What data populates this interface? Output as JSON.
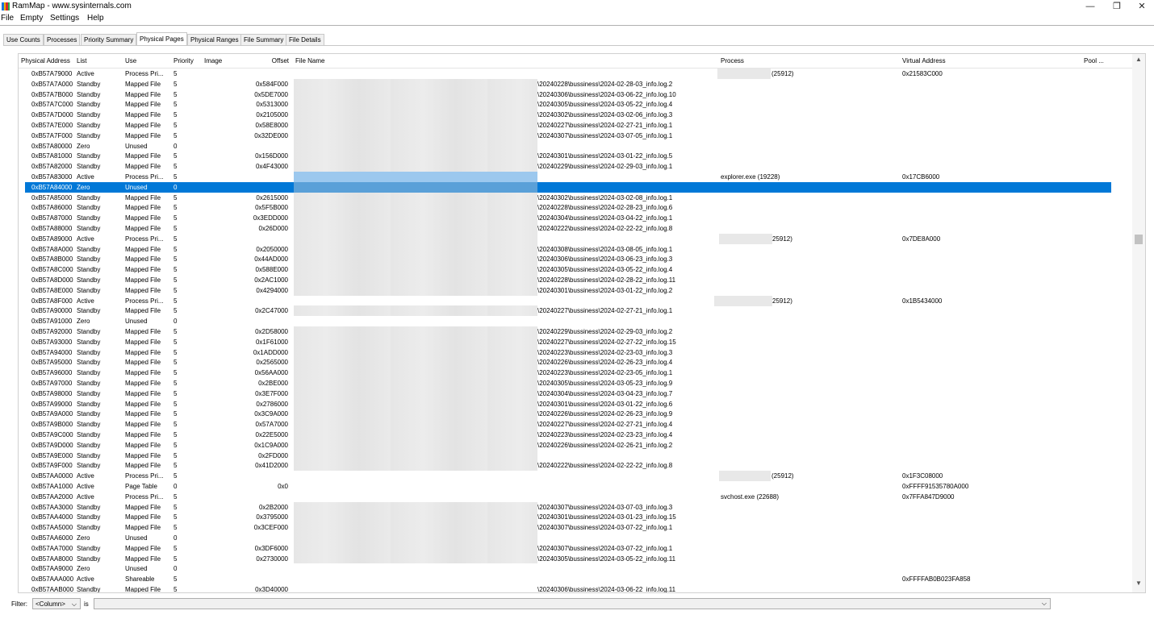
{
  "window": {
    "title": "RamMap - www.sysinternals.com",
    "icon_colors": [
      "#1a73d9",
      "#e8b100",
      "#d9232d",
      "#2aa845"
    ],
    "minimize_glyph": "—",
    "restore_glyph": "❐",
    "close_glyph": "✕"
  },
  "menu": [
    "File",
    "Empty",
    "Settings",
    "Help"
  ],
  "tabs": [
    "Use Counts",
    "Processes",
    "Priority Summary",
    "Physical Pages",
    "Physical Ranges",
    "File Summary",
    "File Details"
  ],
  "active_tab": "Physical Pages",
  "columns": [
    "Physical Address",
    "List",
    "Use",
    "Priority",
    "Image",
    "Offset",
    "File Name",
    "Process",
    "Virtual Address",
    "Pool ..."
  ],
  "rows": [
    {
      "addr": "0xB57A79000",
      "list": "Active",
      "use": "Process Pri...",
      "pri": "5",
      "offset": "",
      "file": "",
      "process": "(25912)",
      "va": "0x21583C000"
    },
    {
      "addr": "0xB57A7A000",
      "list": "Standby",
      "use": "Mapped File",
      "pri": "5",
      "offset": "0x584F000",
      "file": "\\20240228\\bussiness\\2024-02-28-03_info.log.2",
      "process": "",
      "va": ""
    },
    {
      "addr": "0xB57A7B000",
      "list": "Standby",
      "use": "Mapped File",
      "pri": "5",
      "offset": "0x5DE7000",
      "file": "\\20240306\\bussiness\\2024-03-06-22_info.log.10",
      "process": "",
      "va": ""
    },
    {
      "addr": "0xB57A7C000",
      "list": "Standby",
      "use": "Mapped File",
      "pri": "5",
      "offset": "0x5313000",
      "file": "\\20240305\\bussiness\\2024-03-05-22_info.log.4",
      "process": "",
      "va": ""
    },
    {
      "addr": "0xB57A7D000",
      "list": "Standby",
      "use": "Mapped File",
      "pri": "5",
      "offset": "0x2105000",
      "file": "\\20240302\\bussiness\\2024-03-02-06_info.log.3",
      "process": "",
      "va": ""
    },
    {
      "addr": "0xB57A7E000",
      "list": "Standby",
      "use": "Mapped File",
      "pri": "5",
      "offset": "0x58E8000",
      "file": "\\20240227\\bussiness\\2024-02-27-21_info.log.1",
      "process": "",
      "va": ""
    },
    {
      "addr": "0xB57A7F000",
      "list": "Standby",
      "use": "Mapped File",
      "pri": "5",
      "offset": "0x32DE000",
      "file": "\\20240307\\bussiness\\2024-03-07-05_info.log.1",
      "process": "",
      "va": ""
    },
    {
      "addr": "0xB57A80000",
      "list": "Zero",
      "use": "Unused",
      "pri": "0",
      "offset": "",
      "file": "",
      "process": "",
      "va": ""
    },
    {
      "addr": "0xB57A81000",
      "list": "Standby",
      "use": "Mapped File",
      "pri": "5",
      "offset": "0x156D000",
      "file": "\\20240301\\bussiness\\2024-03-01-22_info.log.5",
      "process": "",
      "va": ""
    },
    {
      "addr": "0xB57A82000",
      "list": "Standby",
      "use": "Mapped File",
      "pri": "5",
      "offset": "0x4F43000",
      "file": "\\20240229\\bussiness\\2024-02-29-03_info.log.1",
      "process": "",
      "va": ""
    },
    {
      "addr": "0xB57A83000",
      "list": "Active",
      "use": "Process Pri...",
      "pri": "5",
      "offset": "",
      "file": "",
      "process": "explorer.exe (19228)",
      "va": "0x17CB6000"
    },
    {
      "addr": "0xB57A84000",
      "list": "Zero",
      "use": "Unused",
      "pri": "0",
      "offset": "",
      "file": "",
      "process": "",
      "va": ""
    },
    {
      "addr": "0xB57A85000",
      "list": "Standby",
      "use": "Mapped File",
      "pri": "5",
      "offset": "0x2615000",
      "file": "\\20240302\\bussiness\\2024-03-02-08_info.log.1",
      "process": "",
      "va": ""
    },
    {
      "addr": "0xB57A86000",
      "list": "Standby",
      "use": "Mapped File",
      "pri": "5",
      "offset": "0x5F5B000",
      "file": "\\20240228\\bussiness\\2024-02-28-23_info.log.6",
      "process": "",
      "va": ""
    },
    {
      "addr": "0xB57A87000",
      "list": "Standby",
      "use": "Mapped File",
      "pri": "5",
      "offset": "0x3EDD000",
      "file": "\\20240304\\bussiness\\2024-03-04-22_info.log.1",
      "process": "",
      "va": ""
    },
    {
      "addr": "0xB57A88000",
      "list": "Standby",
      "use": "Mapped File",
      "pri": "5",
      "offset": "0x26D000",
      "file": "\\20240222\\bussiness\\2024-02-22-22_info.log.8",
      "process": "",
      "va": ""
    },
    {
      "addr": "0xB57A89000",
      "list": "Active",
      "use": "Process Pri...",
      "pri": "5",
      "offset": "",
      "file": "",
      "process": "25912)",
      "va": "0x7DE8A000"
    },
    {
      "addr": "0xB57A8A000",
      "list": "Standby",
      "use": "Mapped File",
      "pri": "5",
      "offset": "0x2050000",
      "file": "\\20240308\\bussiness\\2024-03-08-05_info.log.1",
      "process": "",
      "va": ""
    },
    {
      "addr": "0xB57A8B000",
      "list": "Standby",
      "use": "Mapped File",
      "pri": "5",
      "offset": "0x44AD000",
      "file": "\\20240306\\bussiness\\2024-03-06-23_info.log.3",
      "process": "",
      "va": ""
    },
    {
      "addr": "0xB57A8C000",
      "list": "Standby",
      "use": "Mapped File",
      "pri": "5",
      "offset": "0x588E000",
      "file": "\\20240305\\bussiness\\2024-03-05-22_info.log.4",
      "process": "",
      "va": ""
    },
    {
      "addr": "0xB57A8D000",
      "list": "Standby",
      "use": "Mapped File",
      "pri": "5",
      "offset": "0x2AC1000",
      "file": "\\20240228\\bussiness\\2024-02-28-22_info.log.11",
      "process": "",
      "va": ""
    },
    {
      "addr": "0xB57A8E000",
      "list": "Standby",
      "use": "Mapped File",
      "pri": "5",
      "offset": "0x4294000",
      "file": "\\20240301\\bussiness\\2024-03-01-22_info.log.2",
      "process": "",
      "va": ""
    },
    {
      "addr": "0xB57A8F000",
      "list": "Active",
      "use": "Process Pri...",
      "pri": "5",
      "offset": "",
      "file": "",
      "process": "25912)",
      "va": "0x1B5434000"
    },
    {
      "addr": "0xB57A90000",
      "list": "Standby",
      "use": "Mapped File",
      "pri": "5",
      "offset": "0x2C47000",
      "file": "\\20240227\\bussiness\\2024-02-27-21_info.log.1",
      "process": "",
      "va": ""
    },
    {
      "addr": "0xB57A91000",
      "list": "Zero",
      "use": "Unused",
      "pri": "0",
      "offset": "",
      "file": "",
      "process": "",
      "va": ""
    },
    {
      "addr": "0xB57A92000",
      "list": "Standby",
      "use": "Mapped File",
      "pri": "5",
      "offset": "0x2D58000",
      "file": "\\20240229\\bussiness\\2024-02-29-03_info.log.2",
      "process": "",
      "va": ""
    },
    {
      "addr": "0xB57A93000",
      "list": "Standby",
      "use": "Mapped File",
      "pri": "5",
      "offset": "0x1F61000",
      "file": "\\20240227\\bussiness\\2024-02-27-22_info.log.15",
      "process": "",
      "va": ""
    },
    {
      "addr": "0xB57A94000",
      "list": "Standby",
      "use": "Mapped File",
      "pri": "5",
      "offset": "0x1ADD000",
      "file": "\\20240223\\bussiness\\2024-02-23-03_info.log.3",
      "process": "",
      "va": ""
    },
    {
      "addr": "0xB57A95000",
      "list": "Standby",
      "use": "Mapped File",
      "pri": "5",
      "offset": "0x2565000",
      "file": "\\20240226\\bussiness\\2024-02-26-23_info.log.4",
      "process": "",
      "va": ""
    },
    {
      "addr": "0xB57A96000",
      "list": "Standby",
      "use": "Mapped File",
      "pri": "5",
      "offset": "0x56AA000",
      "file": "\\20240223\\bussiness\\2024-02-23-05_info.log.1",
      "process": "",
      "va": ""
    },
    {
      "addr": "0xB57A97000",
      "list": "Standby",
      "use": "Mapped File",
      "pri": "5",
      "offset": "0x2BE000",
      "file": "\\20240305\\bussiness\\2024-03-05-23_info.log.9",
      "process": "",
      "va": ""
    },
    {
      "addr": "0xB57A98000",
      "list": "Standby",
      "use": "Mapped File",
      "pri": "5",
      "offset": "0x3E7F000",
      "file": "\\20240304\\bussiness\\2024-03-04-23_info.log.7",
      "process": "",
      "va": ""
    },
    {
      "addr": "0xB57A99000",
      "list": "Standby",
      "use": "Mapped File",
      "pri": "5",
      "offset": "0x2786000",
      "file": "\\20240301\\bussiness\\2024-03-01-22_info.log.6",
      "process": "",
      "va": ""
    },
    {
      "addr": "0xB57A9A000",
      "list": "Standby",
      "use": "Mapped File",
      "pri": "5",
      "offset": "0x3C9A000",
      "file": "\\20240226\\bussiness\\2024-02-26-23_info.log.9",
      "process": "",
      "va": ""
    },
    {
      "addr": "0xB57A9B000",
      "list": "Standby",
      "use": "Mapped File",
      "pri": "5",
      "offset": "0x57A7000",
      "file": "\\20240227\\bussiness\\2024-02-27-21_info.log.4",
      "process": "",
      "va": ""
    },
    {
      "addr": "0xB57A9C000",
      "list": "Standby",
      "use": "Mapped File",
      "pri": "5",
      "offset": "0x22E5000",
      "file": "\\20240223\\bussiness\\2024-02-23-23_info.log.4",
      "process": "",
      "va": ""
    },
    {
      "addr": "0xB57A9D000",
      "list": "Standby",
      "use": "Mapped File",
      "pri": "5",
      "offset": "0x1C9A000",
      "file": "\\20240226\\bussiness\\2024-02-26-21_info.log.2",
      "process": "",
      "va": ""
    },
    {
      "addr": "0xB57A9E000",
      "list": "Standby",
      "use": "Mapped File",
      "pri": "5",
      "offset": "0x2FD000",
      "file": "",
      "process": "",
      "va": ""
    },
    {
      "addr": "0xB57A9F000",
      "list": "Standby",
      "use": "Mapped File",
      "pri": "5",
      "offset": "0x41D2000",
      "file": "\\20240222\\bussiness\\2024-02-22-22_info.log.8",
      "process": "",
      "va": ""
    },
    {
      "addr": "0xB57AA0000",
      "list": "Active",
      "use": "Process Pri...",
      "pri": "5",
      "offset": "",
      "file": "",
      "process": "(25912)",
      "va": "0x1F3C08000"
    },
    {
      "addr": "0xB57AA1000",
      "list": "Active",
      "use": "Page Table",
      "pri": "0",
      "offset": "0x0",
      "file": "",
      "process": "",
      "va": "0xFFFF91535780A000"
    },
    {
      "addr": "0xB57AA2000",
      "list": "Active",
      "use": "Process Pri...",
      "pri": "5",
      "offset": "",
      "file": "",
      "process": "svchost.exe (22688)",
      "va": "0x7FFA847D9000"
    },
    {
      "addr": "0xB57AA3000",
      "list": "Standby",
      "use": "Mapped File",
      "pri": "5",
      "offset": "0x2B2000",
      "file": "\\20240307\\bussiness\\2024-03-07-03_info.log.3",
      "process": "",
      "va": ""
    },
    {
      "addr": "0xB57AA4000",
      "list": "Standby",
      "use": "Mapped File",
      "pri": "5",
      "offset": "0x3795000",
      "file": "\\20240301\\bussiness\\2024-03-01-23_info.log.15",
      "process": "",
      "va": ""
    },
    {
      "addr": "0xB57AA5000",
      "list": "Standby",
      "use": "Mapped File",
      "pri": "5",
      "offset": "0x3CEF000",
      "file": "\\20240307\\bussiness\\2024-03-07-22_info.log.1",
      "process": "",
      "va": ""
    },
    {
      "addr": "0xB57AA6000",
      "list": "Zero",
      "use": "Unused",
      "pri": "0",
      "offset": "",
      "file": "",
      "process": "",
      "va": ""
    },
    {
      "addr": "0xB57AA7000",
      "list": "Standby",
      "use": "Mapped File",
      "pri": "5",
      "offset": "0x3DF6000",
      "file": "\\20240307\\bussiness\\2024-03-07-22_info.log.1",
      "process": "",
      "va": ""
    },
    {
      "addr": "0xB57AA8000",
      "list": "Standby",
      "use": "Mapped File",
      "pri": "5",
      "offset": "0x2730000",
      "file": "\\20240305\\bussiness\\2024-03-05-22_info.log.11",
      "process": "",
      "va": ""
    },
    {
      "addr": "0xB57AA9000",
      "list": "Zero",
      "use": "Unused",
      "pri": "0",
      "offset": "",
      "file": "",
      "process": "",
      "va": ""
    },
    {
      "addr": "0xB57AAA000",
      "list": "Active",
      "use": "Shareable",
      "pri": "5",
      "offset": "",
      "file": "",
      "process": "",
      "va": "0xFFFFAB0B023FA858"
    },
    {
      "addr": "0xB57AAB000",
      "list": "Standby",
      "use": "Mapped File",
      "pri": "5",
      "offset": "0x3D40000",
      "file": "\\20240306\\bussiness\\2024-03-06-22_info.log.11",
      "process": "",
      "va": ""
    }
  ],
  "selected_row_index": 11,
  "filter": {
    "label": "Filter:",
    "column_value": "<Column>",
    "is_label": "is",
    "value": ""
  },
  "colors": {
    "selection": "#0078d7"
  }
}
